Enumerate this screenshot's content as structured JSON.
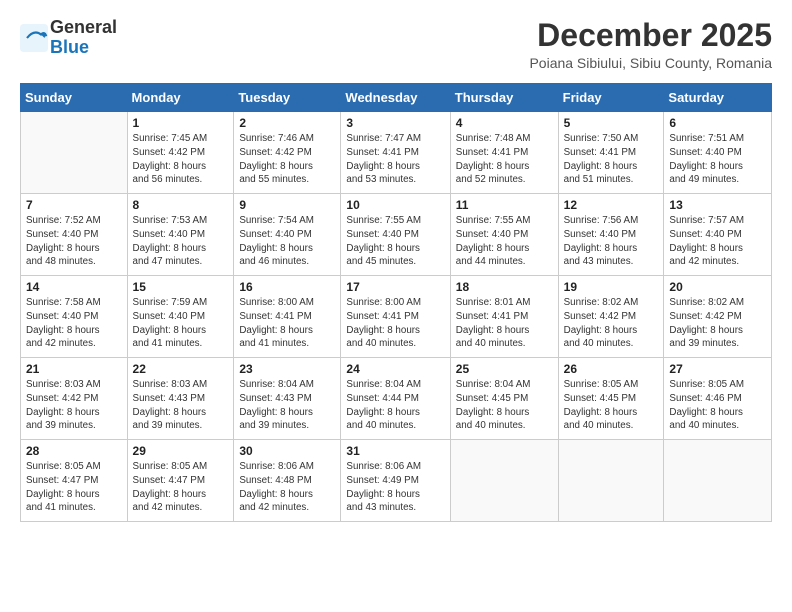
{
  "header": {
    "logo_general": "General",
    "logo_blue": "Blue",
    "month_title": "December 2025",
    "location": "Poiana Sibiului, Sibiu County, Romania"
  },
  "weekdays": [
    "Sunday",
    "Monday",
    "Tuesday",
    "Wednesday",
    "Thursday",
    "Friday",
    "Saturday"
  ],
  "weeks": [
    [
      {
        "day": "",
        "info": ""
      },
      {
        "day": "1",
        "info": "Sunrise: 7:45 AM\nSunset: 4:42 PM\nDaylight: 8 hours\nand 56 minutes."
      },
      {
        "day": "2",
        "info": "Sunrise: 7:46 AM\nSunset: 4:42 PM\nDaylight: 8 hours\nand 55 minutes."
      },
      {
        "day": "3",
        "info": "Sunrise: 7:47 AM\nSunset: 4:41 PM\nDaylight: 8 hours\nand 53 minutes."
      },
      {
        "day": "4",
        "info": "Sunrise: 7:48 AM\nSunset: 4:41 PM\nDaylight: 8 hours\nand 52 minutes."
      },
      {
        "day": "5",
        "info": "Sunrise: 7:50 AM\nSunset: 4:41 PM\nDaylight: 8 hours\nand 51 minutes."
      },
      {
        "day": "6",
        "info": "Sunrise: 7:51 AM\nSunset: 4:40 PM\nDaylight: 8 hours\nand 49 minutes."
      }
    ],
    [
      {
        "day": "7",
        "info": "Sunrise: 7:52 AM\nSunset: 4:40 PM\nDaylight: 8 hours\nand 48 minutes."
      },
      {
        "day": "8",
        "info": "Sunrise: 7:53 AM\nSunset: 4:40 PM\nDaylight: 8 hours\nand 47 minutes."
      },
      {
        "day": "9",
        "info": "Sunrise: 7:54 AM\nSunset: 4:40 PM\nDaylight: 8 hours\nand 46 minutes."
      },
      {
        "day": "10",
        "info": "Sunrise: 7:55 AM\nSunset: 4:40 PM\nDaylight: 8 hours\nand 45 minutes."
      },
      {
        "day": "11",
        "info": "Sunrise: 7:55 AM\nSunset: 4:40 PM\nDaylight: 8 hours\nand 44 minutes."
      },
      {
        "day": "12",
        "info": "Sunrise: 7:56 AM\nSunset: 4:40 PM\nDaylight: 8 hours\nand 43 minutes."
      },
      {
        "day": "13",
        "info": "Sunrise: 7:57 AM\nSunset: 4:40 PM\nDaylight: 8 hours\nand 42 minutes."
      }
    ],
    [
      {
        "day": "14",
        "info": "Sunrise: 7:58 AM\nSunset: 4:40 PM\nDaylight: 8 hours\nand 42 minutes."
      },
      {
        "day": "15",
        "info": "Sunrise: 7:59 AM\nSunset: 4:40 PM\nDaylight: 8 hours\nand 41 minutes."
      },
      {
        "day": "16",
        "info": "Sunrise: 8:00 AM\nSunset: 4:41 PM\nDaylight: 8 hours\nand 41 minutes."
      },
      {
        "day": "17",
        "info": "Sunrise: 8:00 AM\nSunset: 4:41 PM\nDaylight: 8 hours\nand 40 minutes."
      },
      {
        "day": "18",
        "info": "Sunrise: 8:01 AM\nSunset: 4:41 PM\nDaylight: 8 hours\nand 40 minutes."
      },
      {
        "day": "19",
        "info": "Sunrise: 8:02 AM\nSunset: 4:42 PM\nDaylight: 8 hours\nand 40 minutes."
      },
      {
        "day": "20",
        "info": "Sunrise: 8:02 AM\nSunset: 4:42 PM\nDaylight: 8 hours\nand 39 minutes."
      }
    ],
    [
      {
        "day": "21",
        "info": "Sunrise: 8:03 AM\nSunset: 4:42 PM\nDaylight: 8 hours\nand 39 minutes."
      },
      {
        "day": "22",
        "info": "Sunrise: 8:03 AM\nSunset: 4:43 PM\nDaylight: 8 hours\nand 39 minutes."
      },
      {
        "day": "23",
        "info": "Sunrise: 8:04 AM\nSunset: 4:43 PM\nDaylight: 8 hours\nand 39 minutes."
      },
      {
        "day": "24",
        "info": "Sunrise: 8:04 AM\nSunset: 4:44 PM\nDaylight: 8 hours\nand 40 minutes."
      },
      {
        "day": "25",
        "info": "Sunrise: 8:04 AM\nSunset: 4:45 PM\nDaylight: 8 hours\nand 40 minutes."
      },
      {
        "day": "26",
        "info": "Sunrise: 8:05 AM\nSunset: 4:45 PM\nDaylight: 8 hours\nand 40 minutes."
      },
      {
        "day": "27",
        "info": "Sunrise: 8:05 AM\nSunset: 4:46 PM\nDaylight: 8 hours\nand 40 minutes."
      }
    ],
    [
      {
        "day": "28",
        "info": "Sunrise: 8:05 AM\nSunset: 4:47 PM\nDaylight: 8 hours\nand 41 minutes."
      },
      {
        "day": "29",
        "info": "Sunrise: 8:05 AM\nSunset: 4:47 PM\nDaylight: 8 hours\nand 42 minutes."
      },
      {
        "day": "30",
        "info": "Sunrise: 8:06 AM\nSunset: 4:48 PM\nDaylight: 8 hours\nand 42 minutes."
      },
      {
        "day": "31",
        "info": "Sunrise: 8:06 AM\nSunset: 4:49 PM\nDaylight: 8 hours\nand 43 minutes."
      },
      {
        "day": "",
        "info": ""
      },
      {
        "day": "",
        "info": ""
      },
      {
        "day": "",
        "info": ""
      }
    ]
  ]
}
